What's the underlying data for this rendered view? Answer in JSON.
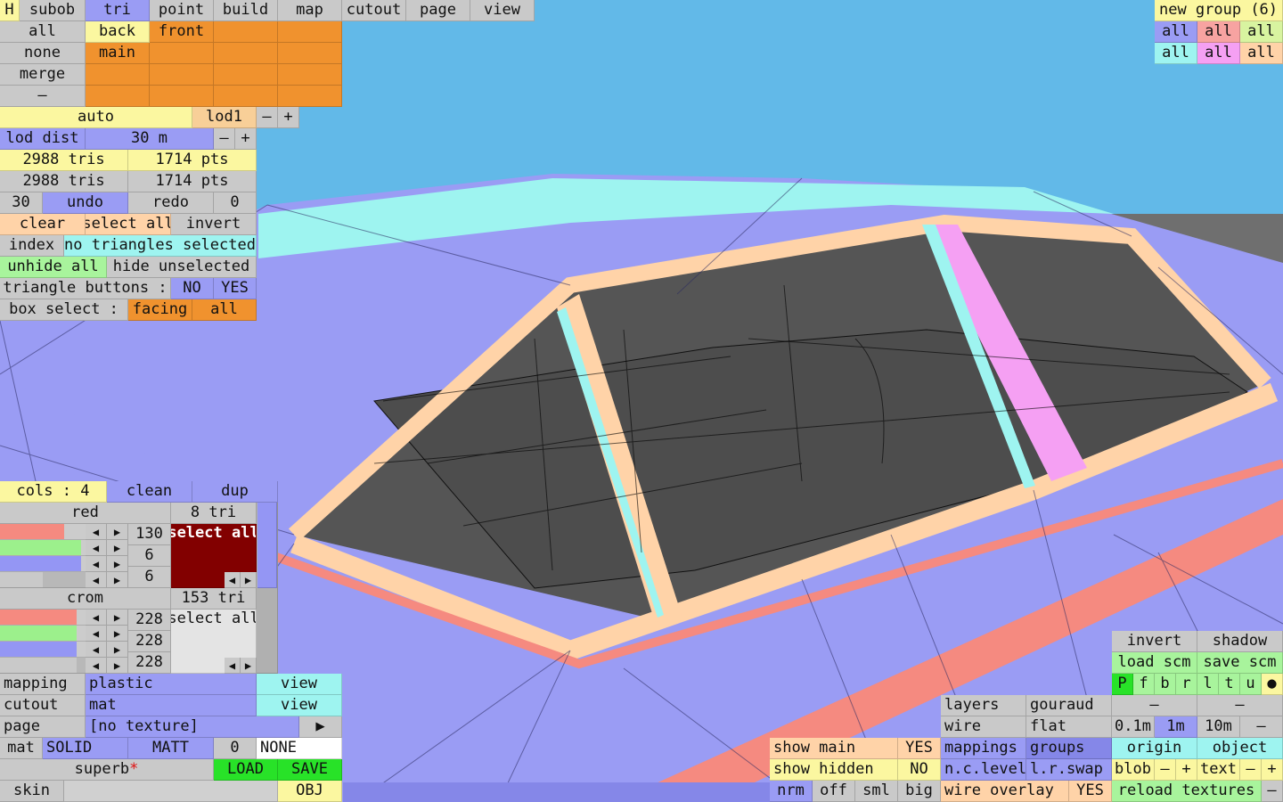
{
  "menu": {
    "h": "H",
    "subob": "subob",
    "tri": "tri",
    "point": "point",
    "build": "build",
    "map": "map",
    "cutout": "cutout",
    "page": "page",
    "view": "view"
  },
  "sel": {
    "all": "all",
    "none": "none",
    "merge": "merge",
    "dash": "–",
    "back": "back",
    "front": "front",
    "main": "main"
  },
  "lod": {
    "auto": "auto",
    "lod1": "lod1",
    "minus": "–",
    "plus": "+",
    "dist_label": "lod dist",
    "dist_value": "30 m"
  },
  "stats": {
    "tris_a": "2988 tris",
    "pts_a": "1714 pts",
    "tris_b": "2988 tris",
    "pts_b": "1714 pts"
  },
  "hist": {
    "num": "30",
    "undo": "undo",
    "redo": "redo",
    "zero": "0"
  },
  "selection": {
    "clear": "clear",
    "select_all": "select all",
    "invert": "invert",
    "index": "index",
    "none_selected": "no triangles selected",
    "unhide_all": "unhide all",
    "hide_unselected": "hide unselected",
    "tri_buttons": "triangle buttons :",
    "no": "NO",
    "yes": "YES",
    "box_select": "box select :",
    "facing": "facing",
    "all": "all"
  },
  "groups": {
    "title": "new group (6)",
    "all": "all"
  },
  "cols": {
    "label": "cols : 4",
    "clean": "clean",
    "dup": "dup",
    "red_name": "red",
    "red_count": "8 tri",
    "red_vals": [
      "130",
      "6",
      "6"
    ],
    "select_all": "select all",
    "crom_name": "crom",
    "crom_count": "153 tri",
    "crom_vals": [
      "228",
      "228",
      "228"
    ],
    "left": "◀",
    "right": "▶"
  },
  "colors": {
    "red": "#f58a80",
    "green": "#9cf08c",
    "blue": "#9496f4",
    "gray": "#b8b8b8",
    "darkred": "#820000"
  },
  "mat": {
    "mapping": "mapping",
    "plastic": "plastic",
    "view": "view",
    "cutout": "cutout",
    "mat_name": "mat",
    "page": "page",
    "no_texture": "[no texture]",
    "play": "▶",
    "mat": "mat",
    "solid": "SOLID",
    "matt": "MATT",
    "zero": "0",
    "none": "NONE",
    "superb": "superb",
    "star": "*",
    "load": "LOAD",
    "save": "SAVE",
    "skin": "skin",
    "obj": "OBJ"
  },
  "render": {
    "invert": "invert",
    "shadow": "shadow",
    "load_scm": "load scm",
    "save_scm": "save scm",
    "letters": [
      "P",
      "f",
      "b",
      "r",
      "l",
      "t",
      "u",
      "●"
    ],
    "dash": "–",
    "d01": "0.1m",
    "d1": "1m",
    "d10": "10m",
    "origin": "origin",
    "object": "object",
    "blob": "blob",
    "minus": "–",
    "plus": "+",
    "text": "text",
    "reload": "reload textures"
  },
  "disp": {
    "layers": "layers",
    "gouraud": "gouraud",
    "wire": "wire",
    "flat": "flat",
    "mappings": "mappings",
    "groups": "groups",
    "nclevel": "n.c.level",
    "lrswap": "l.r.swap",
    "overlay": "wire overlay",
    "yes": "YES",
    "show_main": "show main",
    "show_hidden": "show hidden",
    "no": "NO",
    "nrm": "nrm",
    "off": "off",
    "sml": "sml",
    "big": "big"
  }
}
